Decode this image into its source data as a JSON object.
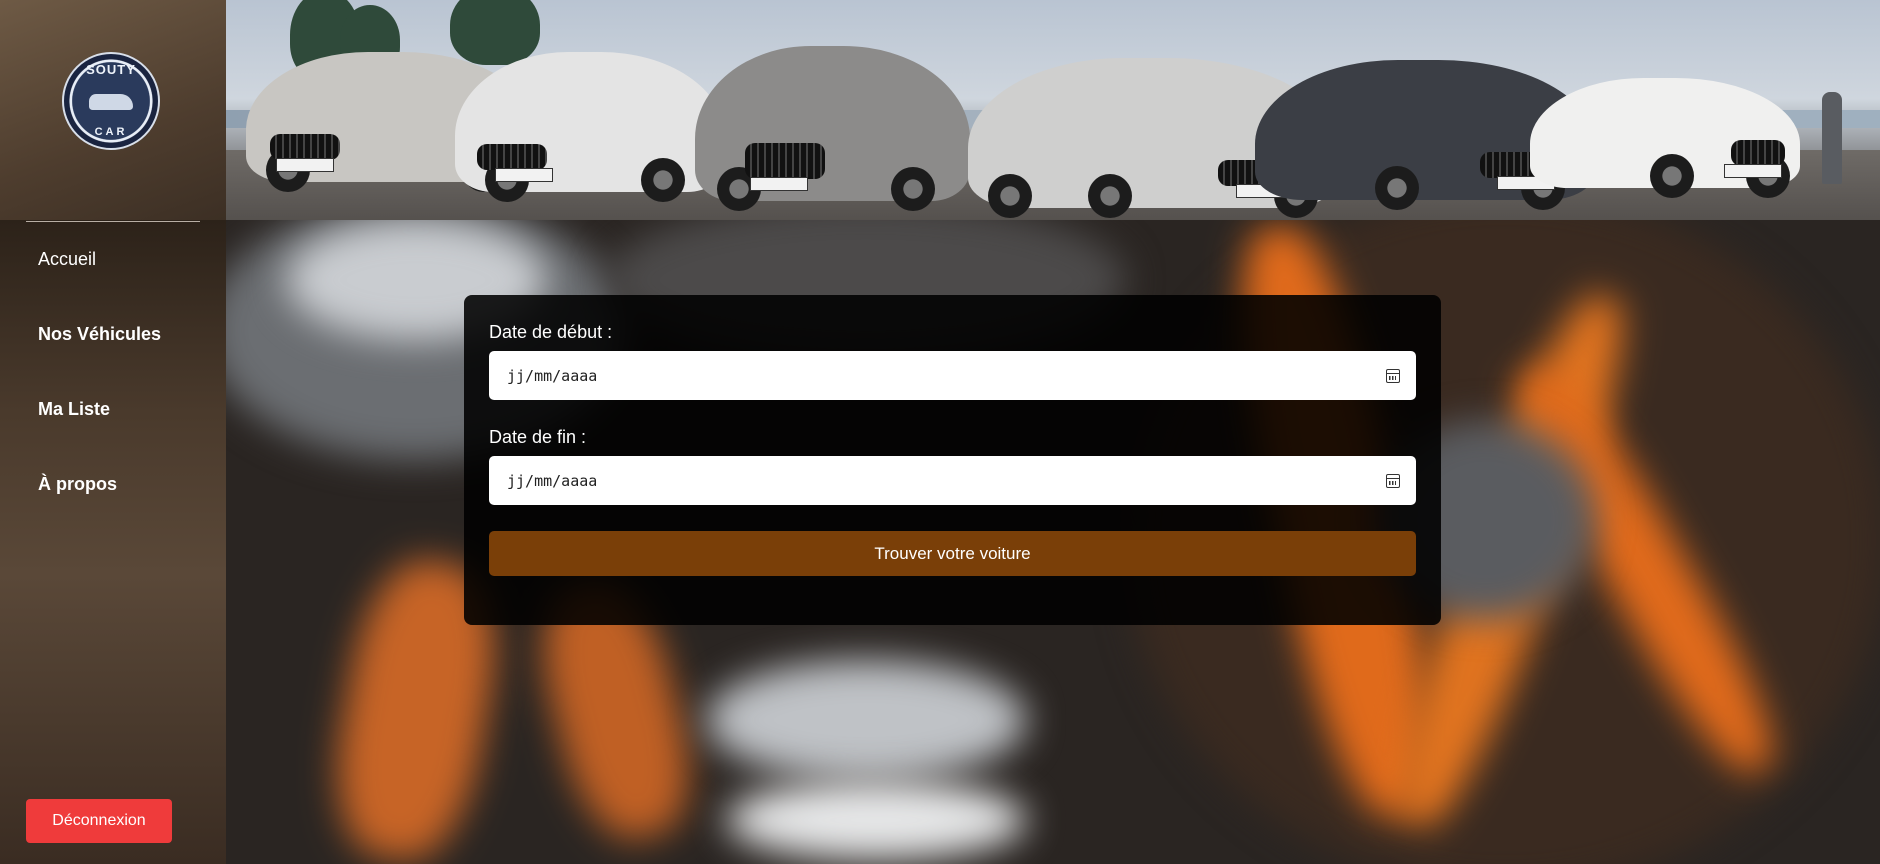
{
  "header": {
    "logo": {
      "top_text": "SOUTY",
      "bottom_text": "CAR"
    }
  },
  "sidebar": {
    "items": [
      {
        "label": "Accueil"
      },
      {
        "label": "Nos Véhicules"
      },
      {
        "label": "Ma Liste"
      },
      {
        "label": "À propos"
      }
    ],
    "logout_label": "Déconnexion"
  },
  "form": {
    "start_label": "Date de début :",
    "start_placeholder": "jj/mm/aaaa",
    "end_label": "Date de fin :",
    "end_placeholder": "jj/mm/aaaa",
    "submit_label": "Trouver votre voiture"
  },
  "colors": {
    "accent_button": "#7a3f08",
    "logout_button": "#ef3b3b",
    "card_bg": "#000000"
  }
}
